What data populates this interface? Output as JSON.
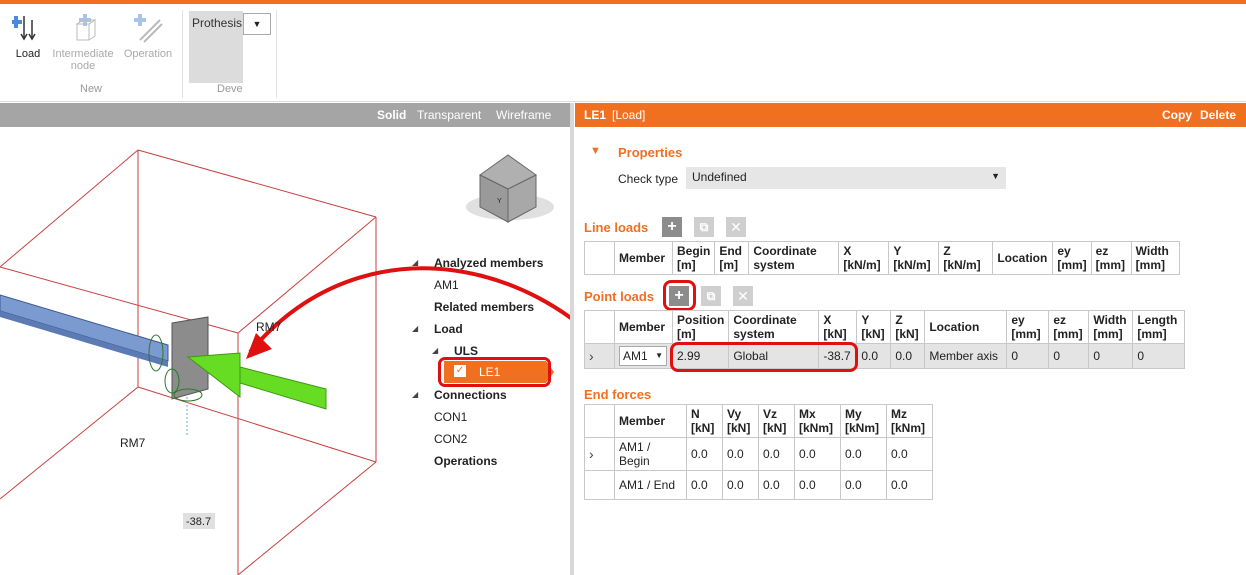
{
  "ribbon": {
    "load_label": "Load",
    "intermediate_node_label": "Intermediate node",
    "operation_label": "Operation",
    "group_new": "New",
    "prothesis_label": "Prothesis",
    "group_deve": "Deve"
  },
  "left_panel": {
    "view_modes": [
      "Solid",
      "Transparent",
      "Wireframe"
    ],
    "scene_labels": {
      "rm7_top": "RM7",
      "rm7_bottom": "RM7",
      "load_value": "-38.7"
    }
  },
  "tree": {
    "analyzed_members": "Analyzed members",
    "am1": "AM1",
    "related_members": "Related members",
    "load": "Load",
    "uls": "ULS",
    "le1": "LE1",
    "connections": "Connections",
    "con1": "CON1",
    "con2": "CON2",
    "operations": "Operations"
  },
  "right_panel": {
    "header": {
      "name": "LE1",
      "type": "[Load]",
      "copy": "Copy",
      "delete": "Delete"
    },
    "properties_title": "Properties",
    "check_type_label": "Check type",
    "check_type_value": "Undefined",
    "line_loads_title": "Line loads",
    "line_loads_headers": [
      "Member",
      "Begin [m]",
      "End [m]",
      "Coordinate system",
      "X [kN/m]",
      "Y [kN/m]",
      "Z [kN/m]",
      "Location",
      "ey [mm]",
      "ez [mm]",
      "Width [mm]"
    ],
    "point_loads_title": "Point loads",
    "point_loads_headers": [
      "Member",
      "Position [m]",
      "Coordinate system",
      "X [kN]",
      "Y [kN]",
      "Z [kN]",
      "Location",
      "ey [mm]",
      "ez [mm]",
      "Width [mm]",
      "Length [mm]"
    ],
    "point_loads_rows": [
      {
        "member": "AM1",
        "position": "2.99",
        "coord": "Global",
        "x": "-38.7",
        "y": "0.0",
        "z": "0.0",
        "location": "Member axis",
        "ey": "0",
        "ez": "0",
        "width": "0",
        "length": "0"
      }
    ],
    "end_forces_title": "End forces",
    "end_forces_headers": [
      "Member",
      "N [kN]",
      "Vy [kN]",
      "Vz [kN]",
      "Mx [kNm]",
      "My [kNm]",
      "Mz [kNm]"
    ],
    "end_forces_rows": [
      {
        "member": "AM1 / Begin",
        "n": "0.0",
        "vy": "0.0",
        "vz": "0.0",
        "mx": "0.0",
        "my": "0.0",
        "mz": "0.0"
      },
      {
        "member": "AM1 / End",
        "n": "0.0",
        "vy": "0.0",
        "vz": "0.0",
        "mx": "0.0",
        "my": "0.0",
        "mz": "0.0"
      }
    ]
  },
  "colors": {
    "accent": "#f07020",
    "highlight": "#e01010",
    "load_arrow": "#66dd22"
  }
}
